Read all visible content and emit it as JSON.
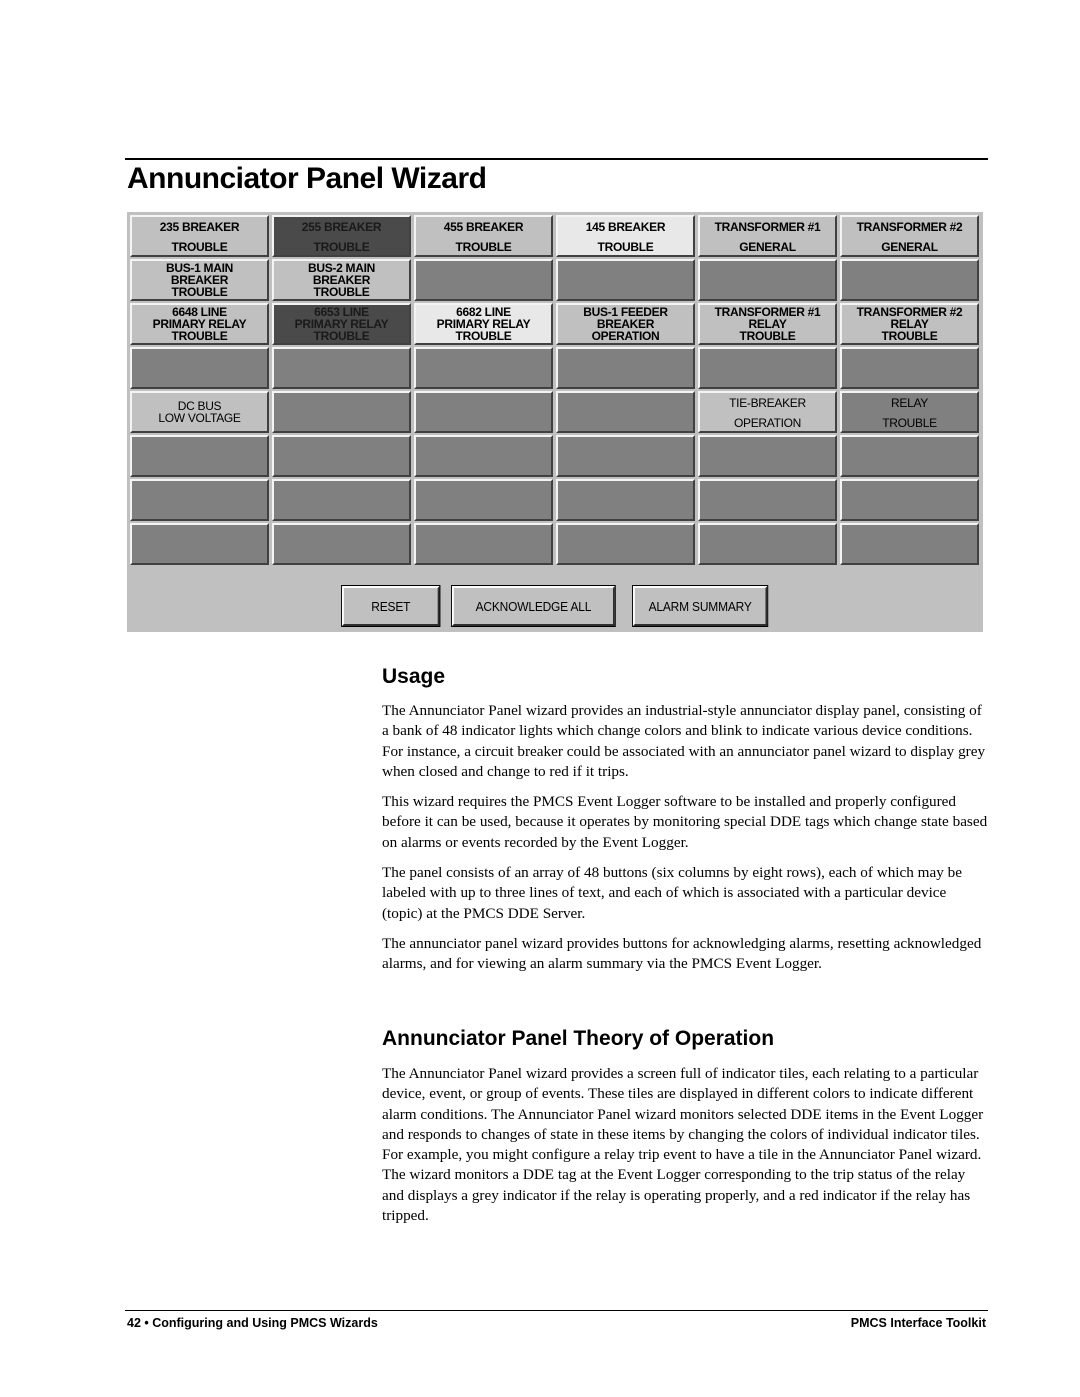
{
  "page": {
    "title": "Annunciator Panel Wizard"
  },
  "panel": {
    "tiles": [
      {
        "lines": [
          "235 BREAKER",
          "TROUBLE"
        ],
        "state": "light",
        "layout": "spread"
      },
      {
        "lines": [
          "255 BREAKER",
          "TROUBLE"
        ],
        "state": "dark",
        "layout": "spread"
      },
      {
        "lines": [
          "455 BREAKER",
          "TROUBLE"
        ],
        "state": "light",
        "layout": "spread"
      },
      {
        "lines": [
          "145 BREAKER",
          "TROUBLE"
        ],
        "state": "white",
        "layout": "spread"
      },
      {
        "lines": [
          "TRANSFORMER #1",
          "GENERAL"
        ],
        "state": "light",
        "layout": "spread"
      },
      {
        "lines": [
          "TRANSFORMER #2",
          "GENERAL"
        ],
        "state": "light",
        "layout": "spread"
      },
      {
        "lines": [
          "BUS-1 MAIN",
          "BREAKER",
          "TROUBLE"
        ],
        "state": "light",
        "layout": "stack"
      },
      {
        "lines": [
          "BUS-2 MAIN",
          "BREAKER",
          "TROUBLE"
        ],
        "state": "light",
        "layout": "stack"
      },
      {
        "lines": [],
        "state": "off",
        "layout": "stack"
      },
      {
        "lines": [],
        "state": "off",
        "layout": "stack"
      },
      {
        "lines": [],
        "state": "off",
        "layout": "stack"
      },
      {
        "lines": [],
        "state": "off",
        "layout": "stack"
      },
      {
        "lines": [
          "6648 LINE",
          "PRIMARY RELAY",
          "TROUBLE"
        ],
        "state": "light",
        "layout": "stack"
      },
      {
        "lines": [
          "6653 LINE",
          "PRIMARY RELAY",
          "TROUBLE"
        ],
        "state": "dark",
        "layout": "stack"
      },
      {
        "lines": [
          "6682 LINE",
          "PRIMARY RELAY",
          "TROUBLE"
        ],
        "state": "white",
        "layout": "stack"
      },
      {
        "lines": [
          "BUS-1 FEEDER",
          "BREAKER",
          "OPERATION"
        ],
        "state": "light",
        "layout": "stack"
      },
      {
        "lines": [
          "TRANSFORMER #1",
          "RELAY",
          "TROUBLE"
        ],
        "state": "light",
        "layout": "stack"
      },
      {
        "lines": [
          "TRANSFORMER #2",
          "RELAY",
          "TROUBLE"
        ],
        "state": "light",
        "layout": "stack"
      },
      {
        "lines": [],
        "state": "off",
        "layout": "stack"
      },
      {
        "lines": [],
        "state": "off",
        "layout": "stack"
      },
      {
        "lines": [],
        "state": "off",
        "layout": "stack"
      },
      {
        "lines": [],
        "state": "off",
        "layout": "stack"
      },
      {
        "lines": [],
        "state": "off",
        "layout": "stack"
      },
      {
        "lines": [],
        "state": "off",
        "layout": "stack"
      },
      {
        "lines": [
          "DC BUS",
          "LOW VOLTAGE"
        ],
        "state": "light",
        "layout": "stack",
        "font": "narrow"
      },
      {
        "lines": [],
        "state": "off",
        "layout": "stack"
      },
      {
        "lines": [],
        "state": "off",
        "layout": "stack"
      },
      {
        "lines": [],
        "state": "off",
        "layout": "stack"
      },
      {
        "lines": [
          "TIE-BREAKER",
          "OPERATION"
        ],
        "state": "light",
        "layout": "spread",
        "font": "narrow"
      },
      {
        "lines": [
          "RELAY",
          "TROUBLE"
        ],
        "state": "off",
        "layout": "spread",
        "font": "narrow"
      },
      {
        "lines": [],
        "state": "off",
        "layout": "stack"
      },
      {
        "lines": [],
        "state": "off",
        "layout": "stack"
      },
      {
        "lines": [],
        "state": "off",
        "layout": "stack"
      },
      {
        "lines": [],
        "state": "off",
        "layout": "stack"
      },
      {
        "lines": [],
        "state": "off",
        "layout": "stack"
      },
      {
        "lines": [],
        "state": "off",
        "layout": "stack"
      },
      {
        "lines": [],
        "state": "off",
        "layout": "stack"
      },
      {
        "lines": [],
        "state": "off",
        "layout": "stack"
      },
      {
        "lines": [],
        "state": "off",
        "layout": "stack"
      },
      {
        "lines": [],
        "state": "off",
        "layout": "stack"
      },
      {
        "lines": [],
        "state": "off",
        "layout": "stack"
      },
      {
        "lines": [],
        "state": "off",
        "layout": "stack"
      },
      {
        "lines": [],
        "state": "off",
        "layout": "stack"
      },
      {
        "lines": [],
        "state": "off",
        "layout": "stack"
      },
      {
        "lines": [],
        "state": "off",
        "layout": "stack"
      },
      {
        "lines": [],
        "state": "off",
        "layout": "stack"
      },
      {
        "lines": [],
        "state": "off",
        "layout": "stack"
      },
      {
        "lines": [],
        "state": "off",
        "layout": "stack"
      }
    ],
    "buttons": {
      "reset": "RESET",
      "acknowledge_all": "ACKNOWLEDGE ALL",
      "alarm_summary": "ALARM SUMMARY"
    },
    "colors": {
      "panel_bg": "#c0c0c0",
      "tile_off": "#808080",
      "tile_light": "#c0c0c0",
      "tile_white": "#e8e8e8",
      "tile_dark": "#4a4a4a"
    }
  },
  "usage": {
    "heading": "Usage",
    "paragraphs": [
      "The Annunciator Panel wizard provides an industrial-style annunciator display panel, consisting of a bank of 48 indicator lights which change colors and blink to indicate various device conditions. For instance, a circuit breaker could be associated with an annunciator panel wizard to display grey when closed and change to red if it trips.",
      "This wizard requires the PMCS Event Logger software to be installed and properly configured before it can be used, because it operates by monitoring special DDE tags which change state based on alarms or events recorded by the Event Logger.",
      "The panel consists of an array of 48 buttons (six columns by eight rows), each of which may be labeled with up to three lines of text, and each of which is associated with a particular device (topic) at the PMCS DDE Server.",
      "The annunciator panel wizard provides buttons for acknowledging alarms, resetting acknowledged alarms, and for viewing an alarm summary via the PMCS Event Logger."
    ]
  },
  "theory": {
    "heading": "Annunciator Panel Theory of Operation",
    "paragraphs": [
      "The Annunciator Panel wizard provides a screen full of indicator tiles, each relating to a particular device, event, or group of events. These tiles are displayed in different colors to indicate different alarm conditions. The Annunciator Panel wizard monitors selected DDE items in the Event Logger and responds to changes of state in these items by changing the colors of individual indicator tiles. For example, you might configure a relay trip event to have a tile in the Annunciator Panel wizard. The wizard monitors a DDE tag at the Event Logger corresponding to the trip status of the relay and displays a grey indicator if the relay is operating properly, and a red indicator if the relay has tripped."
    ]
  },
  "footer": {
    "left": "42 • Configuring and Using PMCS Wizards",
    "right": "PMCS Interface Toolkit"
  }
}
